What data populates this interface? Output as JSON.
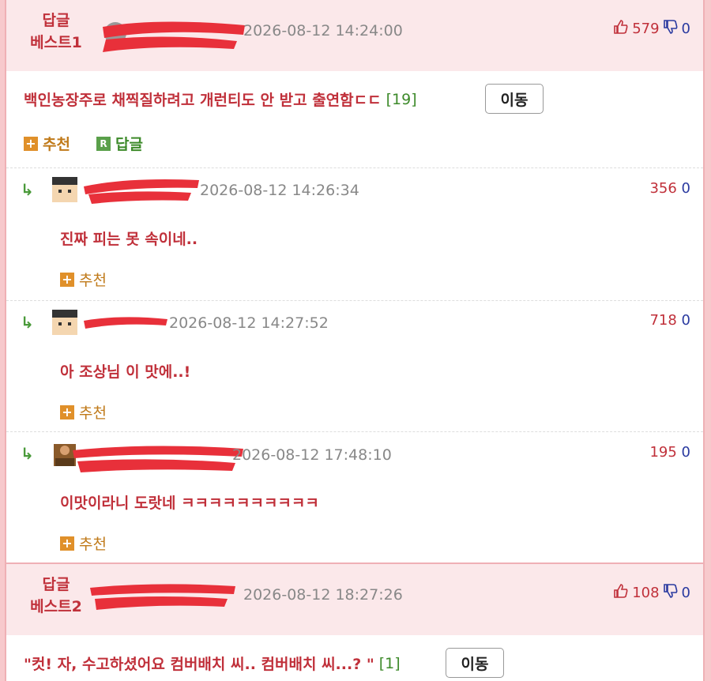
{
  "best1": {
    "label_line1": "답글",
    "label_line2": "베스트1",
    "timestamp": "2026-08-12 14:24:00",
    "up_count": "579",
    "down_count": "0",
    "title": "백인농장주로 채찍질하려고 개런티도 안 받고 출연함ㄷㄷ",
    "reply_count": "[19]",
    "move_label": "이동",
    "recommend_label": "추천",
    "reply_label": "답글"
  },
  "replies": [
    {
      "timestamp": "2026-08-12 14:26:34",
      "up": "356",
      "down": "0",
      "text": "진짜 피는 못 속이네..",
      "recommend_label": "추천"
    },
    {
      "timestamp": "2026-08-12 14:27:52",
      "up": "718",
      "down": "0",
      "text": "아 조상님 이 맛에..!",
      "recommend_label": "추천"
    },
    {
      "timestamp": "2026-08-12 17:48:10",
      "up": "195",
      "down": "0",
      "text": "이맛이라니 도랏네 ㅋㅋㅋㅋㅋㅋㅋㅋㅋㅋ",
      "recommend_label": "추천"
    }
  ],
  "best2": {
    "label_line1": "답글",
    "label_line2": "베스트2",
    "timestamp": "2026-08-12 18:27:26",
    "up_count": "108",
    "down_count": "0",
    "title": "\"컷! 자, 수고하셨어요 컴버배치 씨.. 컴버배치 씨...? \"",
    "reply_count": "[1]",
    "move_label": "이동"
  },
  "colors": {
    "accent_red": "#c0303a",
    "header_bg": "#fbe8ea",
    "border_pink": "#efb0b5",
    "green": "#3d8a2a",
    "orange": "#e0902a"
  }
}
